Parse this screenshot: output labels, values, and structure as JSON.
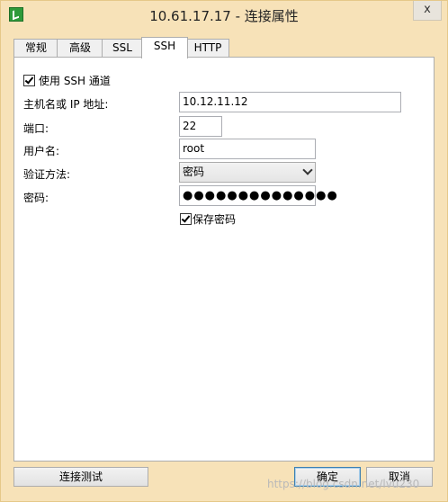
{
  "window": {
    "title": "10.61.17.17 - 连接属性",
    "close_glyph": "x"
  },
  "tabs": [
    {
      "label": "常规"
    },
    {
      "label": "高级"
    },
    {
      "label": "SSL"
    },
    {
      "label": "SSH",
      "active": true
    },
    {
      "label": "HTTP"
    }
  ],
  "ssh": {
    "use_ssh_label": "使用 SSH 通道",
    "use_ssh_checked": true,
    "host_label": "主机名或 IP 地址:",
    "host_value": "10.12.11.12",
    "port_label": "端口:",
    "port_value": "22",
    "user_label": "用户名:",
    "user_value": "root",
    "auth_label": "验证方法:",
    "auth_value": "密码",
    "password_label": "密码:",
    "password_value": "●●●●●●●●●●●●●●",
    "save_password_label": "保存密码",
    "save_password_checked": true
  },
  "buttons": {
    "test": "连接测试",
    "ok": "确定",
    "cancel": "取消"
  },
  "watermark": "https://blog.csdn.net/lvu230"
}
